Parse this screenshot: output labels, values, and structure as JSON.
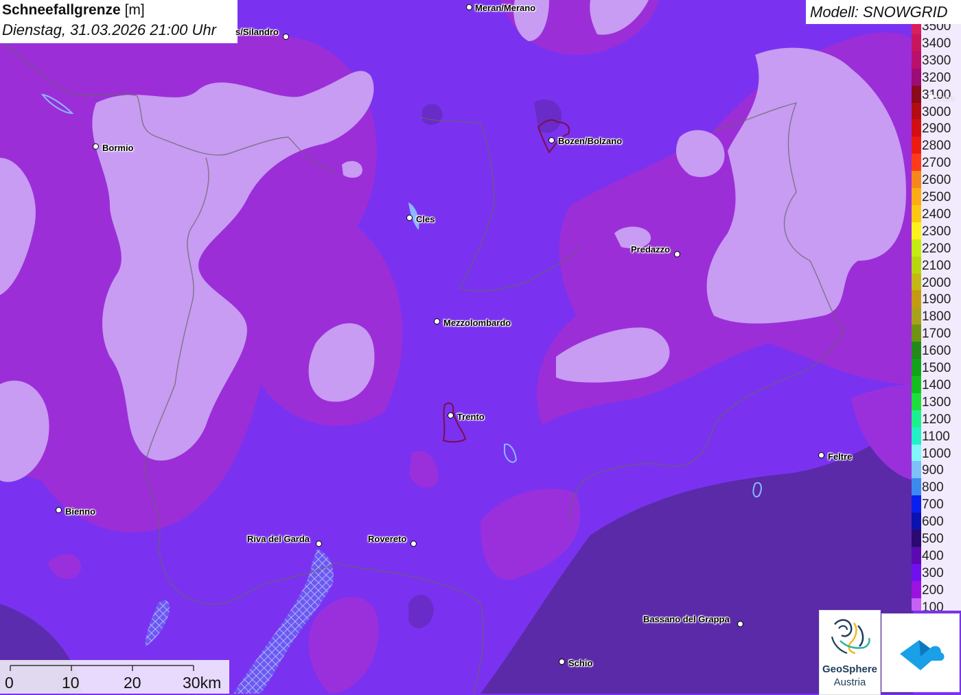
{
  "header": {
    "title_bold": "Schneefallgrenze",
    "title_unit": "[m]",
    "subtitle": "Dienstag, 31.03.2026 21:00 Uhr"
  },
  "model_label": "Modell: SNOWGRID",
  "legend": [
    {
      "label": "3500",
      "color": "#d81e5b"
    },
    {
      "label": "3400",
      "color": "#c8155e"
    },
    {
      "label": "3300",
      "color": "#b8106b"
    },
    {
      "label": "3200",
      "color": "#9c0c74"
    },
    {
      "label": "3100",
      "color": "#8a0a1a"
    },
    {
      "label": "3000",
      "color": "#b30d14"
    },
    {
      "label": "2900",
      "color": "#d10e12"
    },
    {
      "label": "2800",
      "color": "#ec1b10"
    },
    {
      "label": "2700",
      "color": "#fd3a1a"
    },
    {
      "label": "2600",
      "color": "#f7861d"
    },
    {
      "label": "2500",
      "color": "#fbab13"
    },
    {
      "label": "2400",
      "color": "#fdc814"
    },
    {
      "label": "2300",
      "color": "#fdf31a"
    },
    {
      "label": "2200",
      "color": "#c4ec12"
    },
    {
      "label": "2100",
      "color": "#b8d70e"
    },
    {
      "label": "2000",
      "color": "#c4b814"
    },
    {
      "label": "1900",
      "color": "#c49a12"
    },
    {
      "label": "1800",
      "color": "#a8a11c"
    },
    {
      "label": "1700",
      "color": "#6f9412"
    },
    {
      "label": "1600",
      "color": "#218a1a"
    },
    {
      "label": "1500",
      "color": "#13a21b"
    },
    {
      "label": "1400",
      "color": "#14be1e"
    },
    {
      "label": "1300",
      "color": "#1dde3a"
    },
    {
      "label": "1200",
      "color": "#1cf08e"
    },
    {
      "label": "1100",
      "color": "#22f0c6"
    },
    {
      "label": "1000",
      "color": "#7ff6f8"
    },
    {
      "label": "900",
      "color": "#7ec0f8"
    },
    {
      "label": "800",
      "color": "#3c8af0"
    },
    {
      "label": "700",
      "color": "#0b1ef0"
    },
    {
      "label": "600",
      "color": "#0a13b0"
    },
    {
      "label": "500",
      "color": "#2a0a70"
    },
    {
      "label": "400",
      "color": "#5a0ab0"
    },
    {
      "label": "300",
      "color": "#7010f0"
    },
    {
      "label": "200",
      "color": "#9a12e0"
    },
    {
      "label": "100",
      "color": "#c760f4"
    }
  ],
  "cities": [
    {
      "name": "Meran/Merano"
    },
    {
      "name": "s/Silandro"
    },
    {
      "name": "Bormio"
    },
    {
      "name": "Bozen/Bolzano"
    },
    {
      "name": "Cles"
    },
    {
      "name": "Predazzo"
    },
    {
      "name": "Mezzolombardo"
    },
    {
      "name": "Trento"
    },
    {
      "name": "Feltre"
    },
    {
      "name": "Bienno"
    },
    {
      "name": "Riva del Garda"
    },
    {
      "name": "Rovereto"
    },
    {
      "name": "Bassano del Grappa"
    },
    {
      "name": "Schio"
    },
    {
      "name": "Corti"
    }
  ],
  "scale_bar": {
    "labels": [
      "0",
      "10",
      "20",
      "30km"
    ]
  },
  "logos": {
    "geosphere_name": "GeoSphere",
    "geosphere_sub": "Austria"
  },
  "colors": {
    "base_purple": "#7a32f0",
    "dark_purple": "#5a2aa8",
    "light_lilac": "#c79cf2",
    "magenta": "#9c2ed8",
    "brand_blue": "#1aa0e8"
  }
}
